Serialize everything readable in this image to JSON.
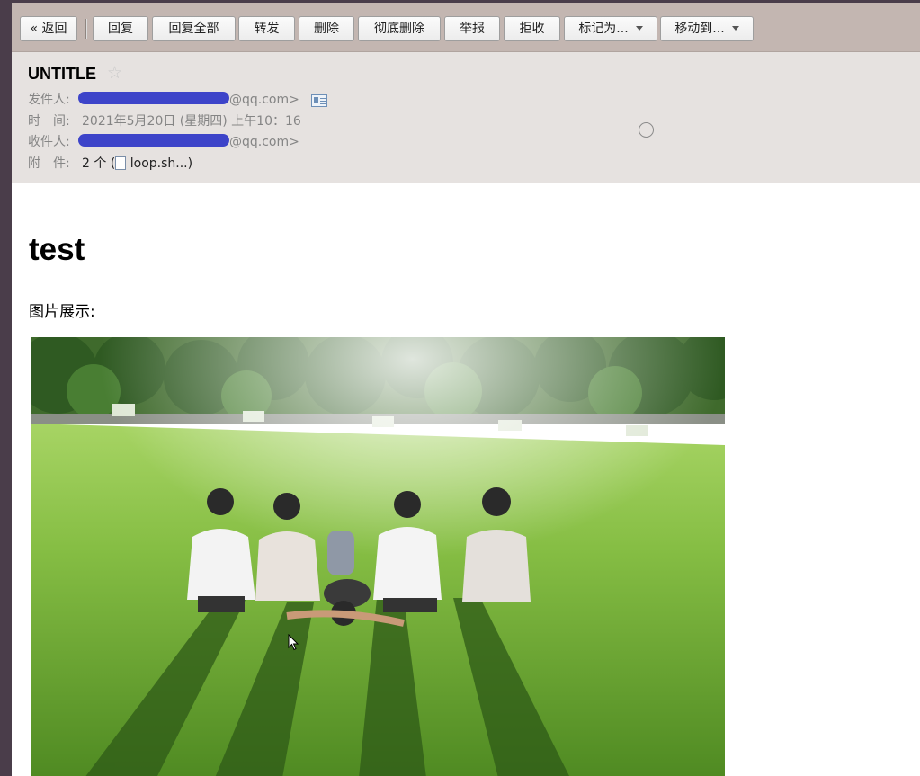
{
  "toolbar": {
    "back": "« 返回",
    "reply": "回复",
    "reply_all": "回复全部",
    "forward": "转发",
    "delete": "删除",
    "delete_permanently": "彻底删除",
    "report": "举报",
    "reject": "拒收",
    "mark_as": "标记为...",
    "move_to": "移动到..."
  },
  "email": {
    "subject": "UNTITLE",
    "from_label": "发件人:",
    "from_value": "@qq.com>",
    "time_label": "时　间:",
    "time_value": "2021年5月20日 (星期四) 上午10：16",
    "to_label": "收件人:",
    "to_value": "@qq.com>",
    "attach_label": "附　件:",
    "attach_count": "2 个 (",
    "attach_name": "loop.sh...)"
  },
  "body": {
    "title": "test",
    "caption": "图片展示:"
  },
  "colors": {
    "toolbar_bg": "#c3b6b1",
    "header_bg": "#e6e2e0",
    "redaction": "#3d44c9",
    "grass": "#78b43a"
  },
  "icons": [
    "star-icon",
    "contact-card-icon",
    "file-icon",
    "dropdown-caret-icon",
    "mouse-cursor-icon"
  ]
}
